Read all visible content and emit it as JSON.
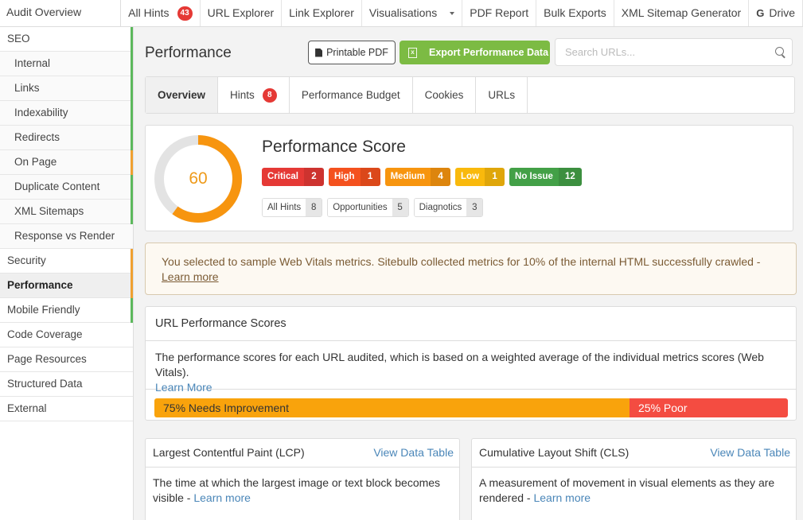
{
  "topnav": {
    "brand": "Audit Overview",
    "items": [
      {
        "label": "All Hints",
        "badge": "43"
      },
      {
        "label": "URL Explorer"
      },
      {
        "label": "Link Explorer"
      },
      {
        "label": "Visualisations"
      },
      {
        "label": "PDF Report"
      },
      {
        "label": "Bulk Exports"
      },
      {
        "label": "XML Sitemap Generator"
      },
      {
        "label": "Drive",
        "icon": "G"
      }
    ]
  },
  "sidebar": {
    "items": [
      {
        "label": "SEO",
        "status": "good"
      },
      {
        "label": "Internal",
        "status": "good"
      },
      {
        "label": "Links",
        "status": "good"
      },
      {
        "label": "Indexability",
        "status": "good"
      },
      {
        "label": "Redirects",
        "status": "good"
      },
      {
        "label": "On Page",
        "status": "warning"
      },
      {
        "label": "Duplicate Content",
        "status": "good"
      },
      {
        "label": "XML Sitemaps",
        "status": "good"
      },
      {
        "label": "Response vs Render",
        "status": "none"
      },
      {
        "label": "Security",
        "status": "warning"
      },
      {
        "label": "Performance",
        "status": "warning",
        "active": true
      },
      {
        "label": "Mobile Friendly",
        "status": "good"
      },
      {
        "label": "Code Coverage",
        "status": "none"
      },
      {
        "label": "Page Resources",
        "status": "none"
      },
      {
        "label": "Structured Data",
        "status": "none"
      },
      {
        "label": "External",
        "status": "none"
      }
    ]
  },
  "status_colors": {
    "good": "#5cb85c",
    "warning": "#f0a030"
  },
  "header": {
    "title": "Performance",
    "printable_pdf": "Printable PDF",
    "export": "Export Performance Data",
    "search_placeholder": "Search URLs..."
  },
  "tabs": [
    {
      "label": "Overview",
      "active": true
    },
    {
      "label": "Hints",
      "badge": "8"
    },
    {
      "label": "Performance Budget"
    },
    {
      "label": "Cookies"
    },
    {
      "label": "URLs"
    }
  ],
  "score": {
    "value": 60,
    "max": 100,
    "title": "Performance Score",
    "color": "#f7950f",
    "severities": [
      {
        "label": "Critical",
        "count": "2",
        "color": "#e53935"
      },
      {
        "label": "High",
        "count": "1",
        "color": "#f4511e"
      },
      {
        "label": "Medium",
        "count": "4",
        "color": "#f7950f"
      },
      {
        "label": "Low",
        "count": "1",
        "color": "#f9b90c"
      },
      {
        "label": "No Issue",
        "count": "12",
        "color": "#43a047"
      }
    ],
    "hint_filters": [
      {
        "label": "All Hints",
        "count": "8"
      },
      {
        "label": "Opportunities",
        "count": "5"
      },
      {
        "label": "Diagnotics",
        "count": "3"
      }
    ]
  },
  "alert": {
    "text": "You selected to sample Web Vitals metrics. Sitebulb collected metrics for 10% of the internal HTML successfully crawled - ",
    "link": "Learn more"
  },
  "url_scores": {
    "title": "URL Performance Scores",
    "description": "The performance scores for each URL audited, which is based on a weighted average of the individual metrics scores (Web Vitals).",
    "link": "Learn More",
    "segments": [
      {
        "label": "75% Needs Improvement",
        "percent": 75,
        "color": "#f9a30c",
        "text_color": "#333"
      },
      {
        "label": "25% Poor",
        "percent": 25,
        "color": "#f44c41",
        "text_color": "#fff"
      }
    ]
  },
  "metrics": [
    {
      "title": "Largest Contentful Paint (LCP)",
      "action": "View Data Table",
      "description": "The time at which the largest image or text block becomes visible - ",
      "link": "Learn more"
    },
    {
      "title": "Cumulative Layout Shift (CLS)",
      "action": "View Data Table",
      "description": "A measurement of movement in visual elements as they are rendered - ",
      "link": "Learn more"
    }
  ]
}
